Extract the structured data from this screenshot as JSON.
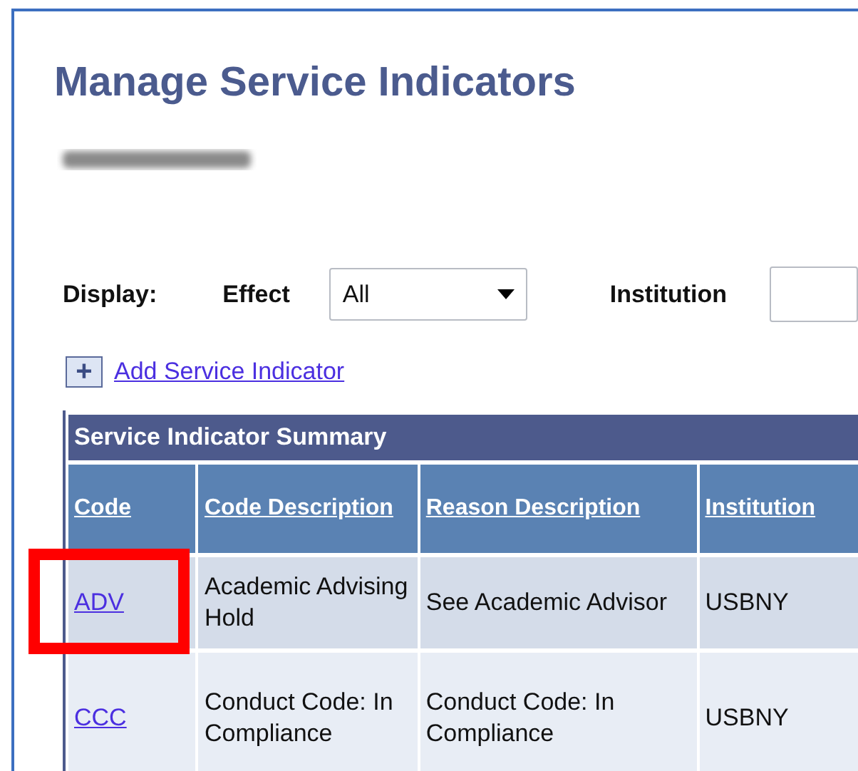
{
  "title": "Manage Service Indicators",
  "filters": {
    "label": "Display:",
    "effect": {
      "label": "Effect",
      "value": "All"
    },
    "institution": {
      "label": "Institution"
    }
  },
  "add_link": {
    "icon": "+",
    "label": "Add Service Indicator"
  },
  "table": {
    "title": "Service Indicator Summary",
    "columns": [
      "Code",
      "Code Description",
      "Reason Description",
      "Institution"
    ],
    "rows": [
      {
        "code": "ADV",
        "code_description": "Academic Advising Hold",
        "reason_description": "See Academic Advisor",
        "institution": "USBNY",
        "highlighted": true
      },
      {
        "code": "CCC",
        "code_description": "Conduct Code: In Compliance",
        "reason_description": "Conduct Code: In Compliance",
        "institution": "USBNY",
        "highlighted": false
      }
    ]
  }
}
